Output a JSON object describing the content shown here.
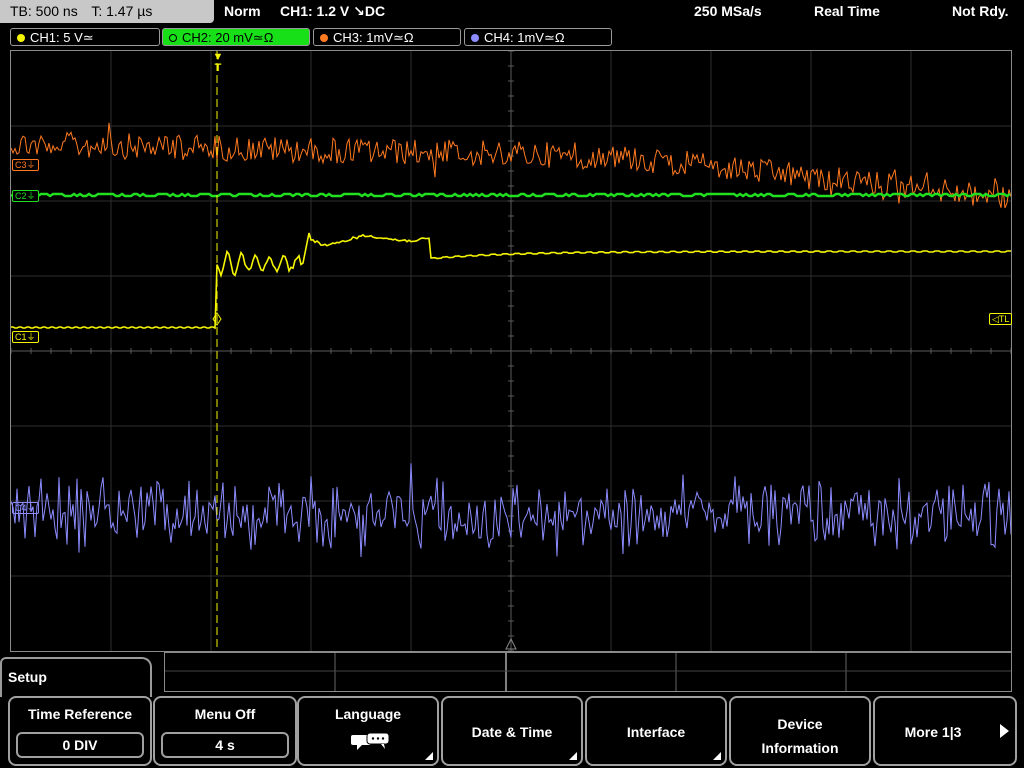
{
  "top_bar": {
    "timebase": "TB: 500 ns",
    "trigger_time": "T: 1.47 µs",
    "trigger_mode": "Norm",
    "trigger_setting": "CH1: 1.2 V ↘DC",
    "sample_rate": "250 MSa/s",
    "acq_mode": "Real Time",
    "state": "Not Rdy."
  },
  "channels": [
    {
      "label": "CH1: 5 V≃",
      "color": "#f5f500"
    },
    {
      "label": "CH2: 20 mV≃Ω",
      "color": "#20e020",
      "active": true
    },
    {
      "label": "CH3: 1mV≃Ω",
      "color": "#ff7a20"
    },
    {
      "label": "CH4: 1mV≃Ω",
      "color": "#8c8cff"
    }
  ],
  "markers": {
    "c3": "C3",
    "c2": "C2",
    "c1": "C1",
    "c4": "C4",
    "trigger_level": "TL",
    "trigger_pos": "T"
  },
  "menu": {
    "title": "Setup",
    "softkeys": [
      {
        "label": "Time Reference",
        "value": "0 DIV"
      },
      {
        "label": "Menu Off",
        "value": "4 s"
      },
      {
        "label": "Language",
        "icon": "speech-bubble-icon"
      },
      {
        "label": "Date & Time"
      },
      {
        "label": "Interface"
      },
      {
        "label": "Device\nInformation"
      },
      {
        "label": "More 1|3"
      }
    ]
  }
}
